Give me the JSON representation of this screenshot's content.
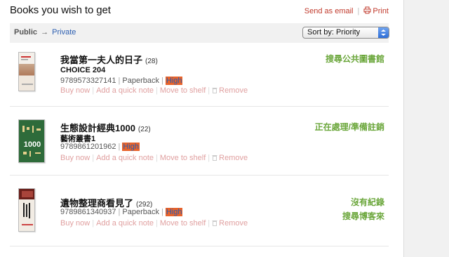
{
  "header": {
    "title": "Books you wish to get",
    "send_email": "Send as email",
    "separator": "|",
    "print": "Print"
  },
  "toolbar": {
    "public_label": "Public",
    "arrow": "→",
    "private_label": "Private",
    "sort_value": "Sort by: Priority"
  },
  "books": [
    {
      "title": "我當第一夫人的日子",
      "count": "(28)",
      "subtitle": "CHOICE 204",
      "isbn": "9789573327141",
      "format": "Paperback",
      "priority": "High",
      "status": [
        "搜尋公共圖書館"
      ]
    },
    {
      "title": "生態設計經典1000",
      "count": "(22)",
      "subtitle": "藝術叢書1",
      "isbn": "9789861201962",
      "format": "",
      "priority": "High",
      "status": [
        "正在處理/準備註銷"
      ]
    },
    {
      "title": "遺物整理商看見了",
      "count": "(292)",
      "subtitle": "",
      "isbn": "9789861340937",
      "format": "Paperback",
      "priority": "High",
      "status": [
        "沒有紀錄",
        "搜尋博客來"
      ]
    }
  ],
  "actions": {
    "buy": "Buy now",
    "note": "Add a quick note",
    "move": "Move to shelf",
    "remove": "Remove",
    "pipe": "|"
  },
  "colors": {
    "accent_red": "#c0392b",
    "status_green": "#6aa63a",
    "priority_bg": "#e8632b",
    "link_blue": "#2a5db0"
  }
}
